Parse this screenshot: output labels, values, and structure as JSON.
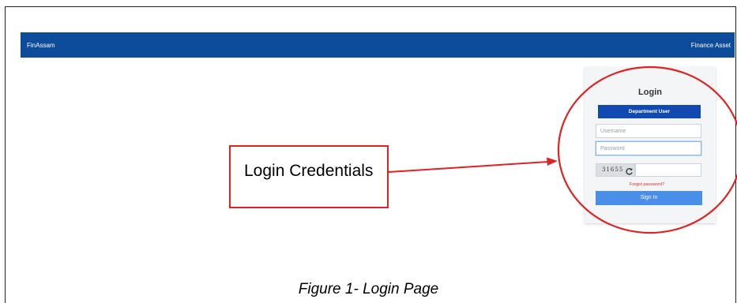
{
  "navbar": {
    "brand": "FinAssam",
    "right_label": "Finance Asset"
  },
  "login": {
    "title": "Login",
    "department_button": "Department User",
    "username_placeholder": "Username",
    "password_placeholder": "Password",
    "captcha_code": "31655",
    "forgot_password": "Forgot password?",
    "sign_in": "Sign In"
  },
  "annotation": {
    "callout_text": "Login Credentials",
    "arrow_color": "#e02222",
    "circle_color": "#e02222"
  },
  "caption": "Figure 1- Login Page",
  "colors": {
    "navbar": "#0d4b9b",
    "department_button": "#1149b3",
    "sign_in_button": "#4a8fe7",
    "forgot_link": "#d0342c"
  },
  "icons": {
    "captcha_refresh": "refresh-icon"
  }
}
